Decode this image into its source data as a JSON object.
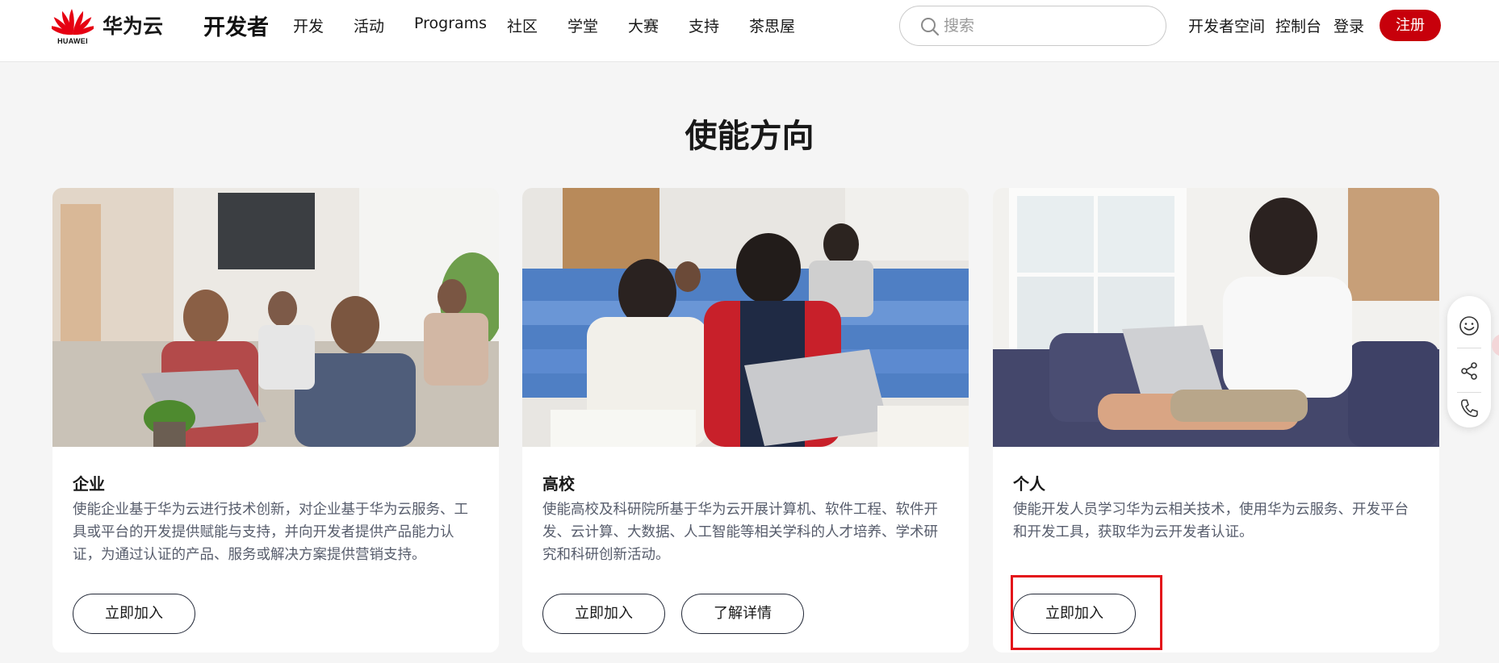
{
  "header": {
    "logo_word": "HUAWEI",
    "brand": "华为云",
    "section": "开发者",
    "nav": [
      "开发",
      "活动",
      "Programs",
      "社区",
      "学堂",
      "大赛",
      "支持",
      "茶思屋"
    ],
    "search_placeholder": "搜索",
    "links": [
      "开发者空间",
      "控制台",
      "登录"
    ],
    "register_label": "注册"
  },
  "main": {
    "title": "使能方向",
    "cards": [
      {
        "title": "企业",
        "description": "使能企业基于华为云进行技术创新，对企业基于华为云服务、工具或平台的开发提供赋能与支持，并向开发者提供产品能力认证，为通过认证的产品、服务或解决方案提供营销支持。",
        "buttons": [
          "立即加入"
        ]
      },
      {
        "title": "高校",
        "description": "使能高校及科研院所基于华为云开展计算机、软件工程、软件开发、云计算、大数据、人工智能等相关学科的人才培养、学术研究和科研创新活动。",
        "buttons": [
          "立即加入",
          "了解详情"
        ]
      },
      {
        "title": "个人",
        "description": "使能开发人员学习华为云相关技术，使用华为云服务、开发平台和开发工具，获取华为云开发者认证。",
        "buttons": [
          "立即加入"
        ]
      }
    ]
  },
  "icons": {
    "search": "search-icon",
    "sidebar": [
      "smiley-icon",
      "share-icon",
      "phone-icon"
    ]
  },
  "colors": {
    "brand_red": "#c7000b",
    "highlight": "#e3131a",
    "page_bg": "#f5f5f5"
  }
}
